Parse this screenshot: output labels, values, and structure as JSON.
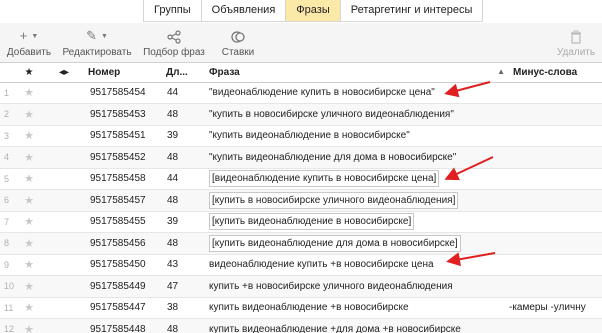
{
  "tabs": [
    {
      "label": "Группы",
      "active": false
    },
    {
      "label": "Объявления",
      "active": false
    },
    {
      "label": "Фразы",
      "active": true
    },
    {
      "label": "Ретаргетинг и интересы",
      "active": false
    }
  ],
  "toolbar": {
    "add_label": "Добавить",
    "edit_label": "Редактировать",
    "phrase_picker_label": "Подбор фраз",
    "bids_label": "Ставки",
    "delete_label": "Удалить"
  },
  "columns": {
    "star": "★",
    "number": "Номер",
    "length": "Дл...",
    "phrase": "Фраза",
    "minus": "Минус-слова"
  },
  "rows": [
    {
      "n": "1",
      "id": "9517585454",
      "len": "44",
      "phrase": "\"видеонаблюдение купить в новосибирске цена\"",
      "minus": ""
    },
    {
      "n": "2",
      "id": "9517585453",
      "len": "48",
      "phrase": "\"купить в новосибирске уличного видеонаблюдения\"",
      "minus": ""
    },
    {
      "n": "3",
      "id": "9517585451",
      "len": "39",
      "phrase": "\"купить видеонаблюдение в новосибирске\"",
      "minus": ""
    },
    {
      "n": "4",
      "id": "9517585452",
      "len": "48",
      "phrase": "\"купить видеонаблюдение для дома в новосибирске\"",
      "minus": ""
    },
    {
      "n": "5",
      "id": "9517585458",
      "len": "44",
      "phrase": "[видеонаблюдение купить в новосибирске цена]",
      "minus": ""
    },
    {
      "n": "6",
      "id": "9517585457",
      "len": "48",
      "phrase": "[купить в новосибирске уличного видеонаблюдения]",
      "minus": ""
    },
    {
      "n": "7",
      "id": "9517585455",
      "len": "39",
      "phrase": "[купить видеонаблюдение в новосибирске]",
      "minus": ""
    },
    {
      "n": "8",
      "id": "9517585456",
      "len": "48",
      "phrase": "[купить видеонаблюдение для дома в новосибирске]",
      "minus": ""
    },
    {
      "n": "9",
      "id": "9517585450",
      "len": "43",
      "phrase": "видеонаблюдение купить +в новосибирске цена",
      "minus": ""
    },
    {
      "n": "10",
      "id": "9517585449",
      "len": "47",
      "phrase": "купить +в новосибирске уличного видеонаблюдения",
      "minus": ""
    },
    {
      "n": "11",
      "id": "9517585447",
      "len": "38",
      "phrase": "купить видеонаблюдение +в новосибирске",
      "minus": "-камеры -уличну"
    },
    {
      "n": "12",
      "id": "9517585448",
      "len": "48",
      "phrase": "купить видеонаблюдение +для дома +в новосибирске",
      "minus": ""
    }
  ],
  "annotation_color": "#e02020"
}
